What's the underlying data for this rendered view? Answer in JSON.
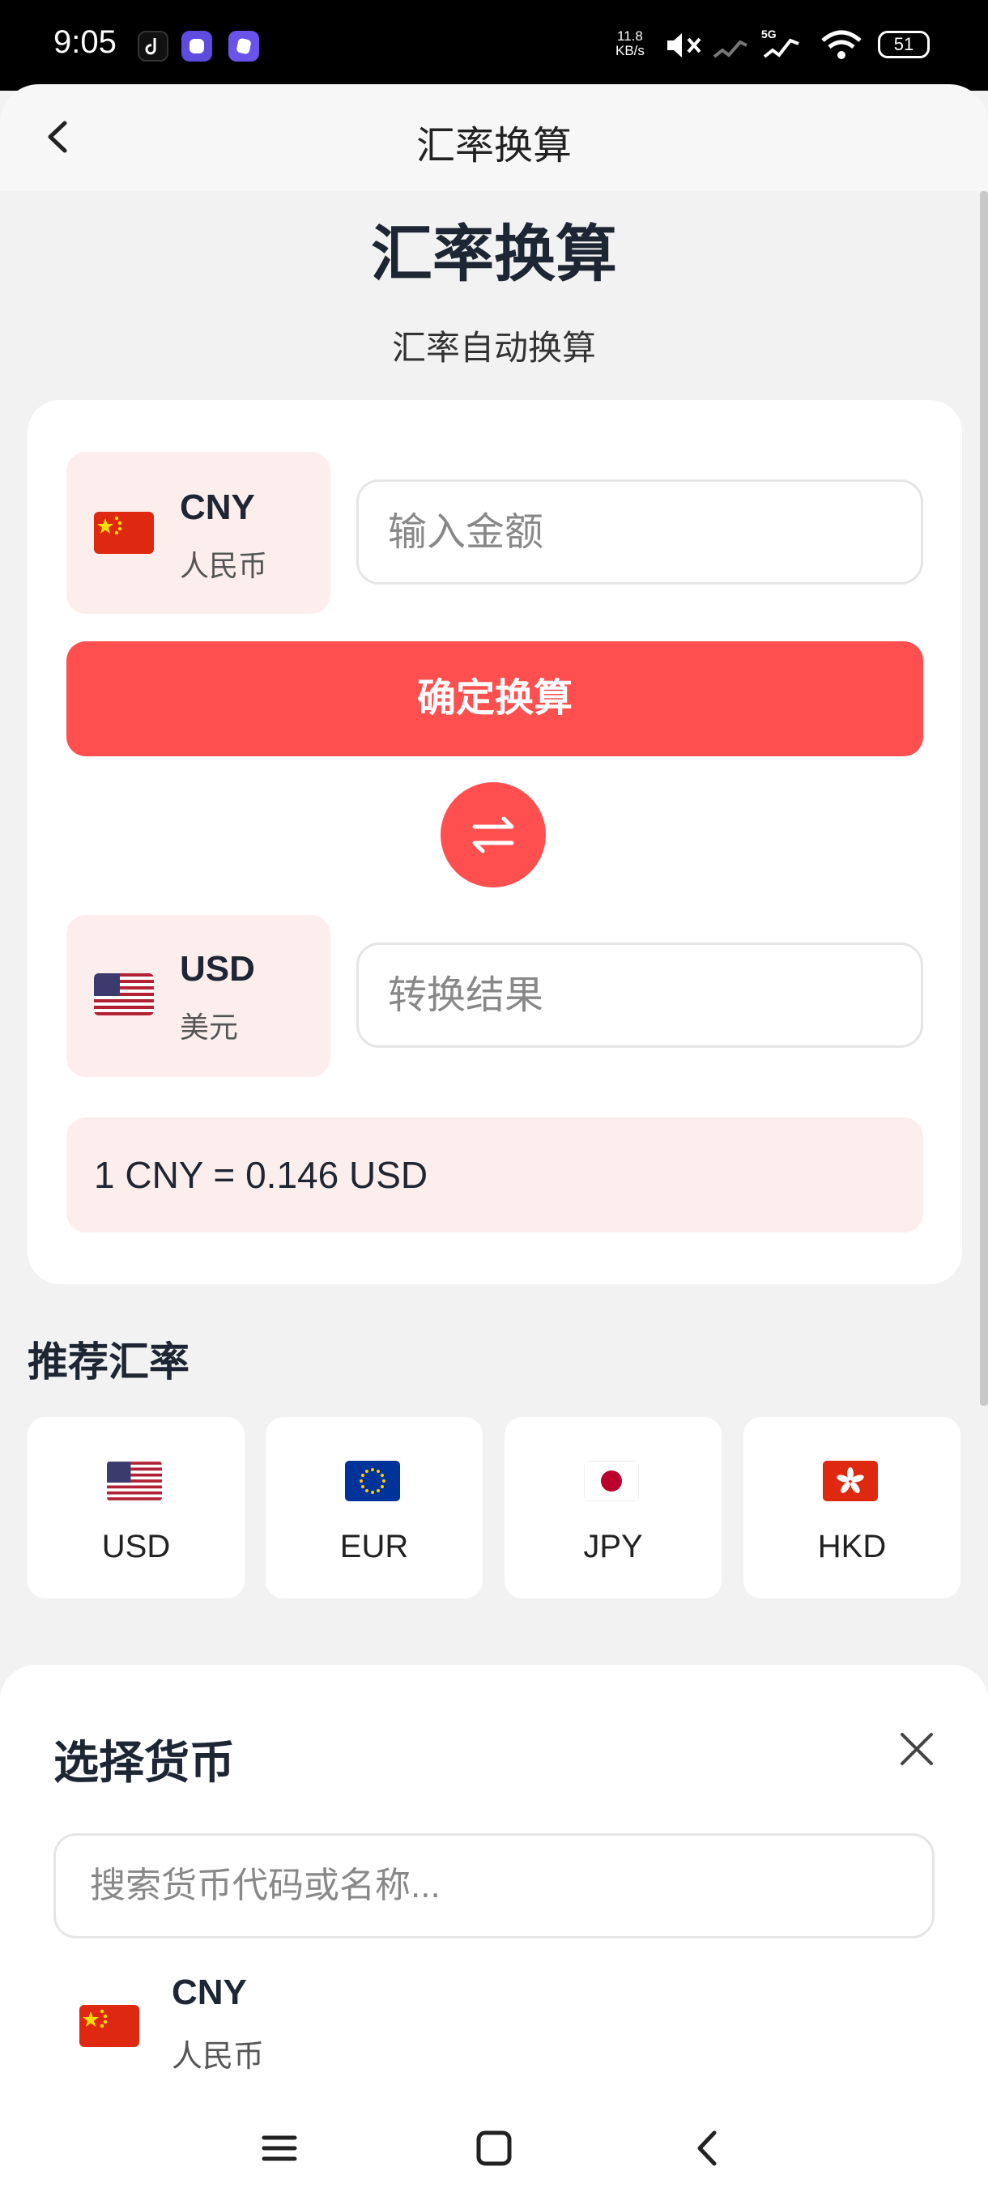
{
  "status_bar": {
    "time": "9:05",
    "net_speed_top": "11.8",
    "net_speed_bottom": "KB/s",
    "signal_label": "5G",
    "battery": "51",
    "icons": [
      "tiktok-icon",
      "app-icon",
      "app-icon",
      "mute-icon",
      "signal-icon",
      "signal-5g-icon",
      "wifi-icon",
      "battery-icon"
    ]
  },
  "header": {
    "title": "汇率换算",
    "back_icon": "chevron-left-icon"
  },
  "page": {
    "title": "汇率换算",
    "subtitle": "汇率自动换算"
  },
  "converter": {
    "from": {
      "code": "CNY",
      "name": "人民币",
      "flag": "china-flag"
    },
    "amount_placeholder": "输入金额",
    "confirm_label": "确定换算",
    "swap_icon": "swap-arrows-icon",
    "to": {
      "code": "USD",
      "name": "美元",
      "flag": "usa-flag"
    },
    "result_placeholder": "转换结果",
    "rate_text": "1 CNY = 0.146 USD"
  },
  "recommended": {
    "title": "推荐汇率",
    "items": [
      {
        "code": "USD",
        "flag": "usa-flag"
      },
      {
        "code": "EUR",
        "flag": "eu-flag"
      },
      {
        "code": "JPY",
        "flag": "japan-flag"
      },
      {
        "code": "HKD",
        "flag": "hong-kong-flag"
      }
    ]
  },
  "currency_sheet": {
    "title": "选择货币",
    "search_placeholder": "搜索货币代码或名称...",
    "items": [
      {
        "code": "CNY",
        "name": "人民币",
        "flag": "china-flag"
      }
    ]
  },
  "nav": {
    "icons": [
      "menu-icon",
      "home-icon",
      "back-icon"
    ]
  },
  "colors": {
    "accent": "#ff4f4f",
    "accent_light": "#fdeeee",
    "text_dark": "#1f2633"
  }
}
